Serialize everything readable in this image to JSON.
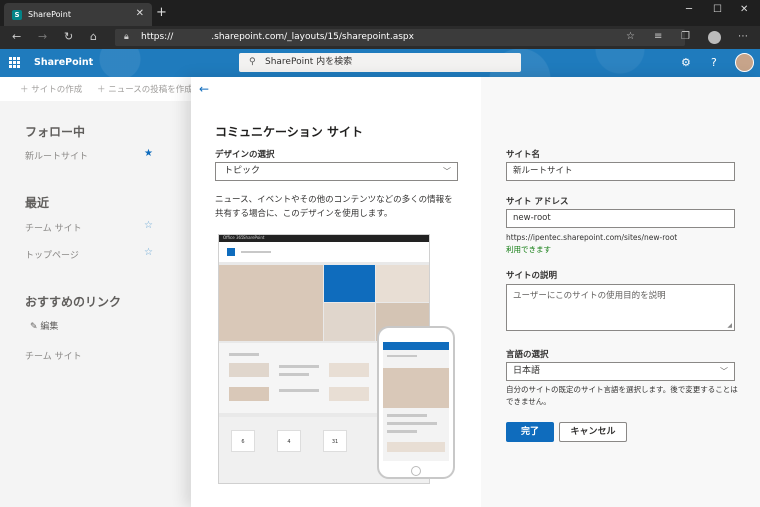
{
  "browser": {
    "tab_title": "SharePoint",
    "tab_close": "✕",
    "new_tab": "+",
    "url_prefix": "https://",
    "url_path": ".sharepoint.com/_layouts/15/sharepoint.aspx",
    "win_min": "─",
    "win_max": "☐",
    "win_close": "✕"
  },
  "suitebar": {
    "brand": "SharePoint",
    "search_placeholder": "SharePoint 内を検索"
  },
  "commandbar": {
    "create_site": "サイトの作成",
    "create_news": "ニュースの投稿を作成"
  },
  "leftnav": {
    "following_heading": "フォロー中",
    "following_items": [
      "新ルートサイト"
    ],
    "recent_heading": "最近",
    "recent_items": [
      "チーム サイト",
      "トップページ"
    ],
    "links_heading": "おすすめのリンク",
    "edit_label": "編集",
    "link_items": [
      "チーム サイト"
    ]
  },
  "panel": {
    "design_title": "コミュニケーション サイト",
    "design_select_label": "デザインの選択",
    "design_select_value": "トピック",
    "design_description": "ニュース、イベントやその他のコンテンツなどの多くの情報を共有する場合に、このデザインを使用します。",
    "preview": {
      "bar_left": "Office 365",
      "bar_mid": "SharePoint",
      "cards": [
        "6",
        "4",
        "31"
      ]
    },
    "site_name_label": "サイト名",
    "site_name_value": "新ルートサイト",
    "site_address_label": "サイト アドレス",
    "site_address_value": "new-root",
    "site_url_preview": "https://ipentec.sharepoint.com/sites/new-root",
    "availability": "利用できます",
    "site_desc_label": "サイトの説明",
    "site_desc_placeholder": "ユーザーにこのサイトの使用目的を説明",
    "language_label": "言語の選択",
    "language_value": "日本語",
    "language_note": "自分のサイトの既定のサイト言語を選択します。後で変更することはできません。",
    "finish_button": "完了",
    "cancel_button": "キャンセル"
  },
  "colors": {
    "accent": "#0f6cbd",
    "suitebar": "#1f7bbd",
    "available": "#107c10"
  }
}
